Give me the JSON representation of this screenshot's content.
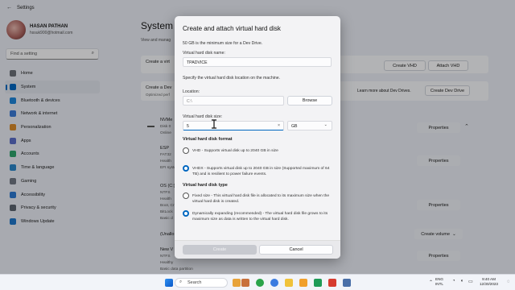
{
  "app": {
    "title": "Settings"
  },
  "user": {
    "name": "HASAN PATHAN",
    "email": "hssuk900@hotmail.com"
  },
  "search": {
    "placeholder": "Find a setting"
  },
  "nav": [
    {
      "label": "Home",
      "icon": "home-icon",
      "color": "#6b6f78"
    },
    {
      "label": "System",
      "icon": "system-icon",
      "color": "#0067c0",
      "active": true
    },
    {
      "label": "Bluetooth & devices",
      "icon": "bluetooth-icon",
      "color": "#1f86d9"
    },
    {
      "label": "Network & internet",
      "icon": "network-icon",
      "color": "#3b7ad6"
    },
    {
      "label": "Personalization",
      "icon": "brush-icon",
      "color": "#d98b2b"
    },
    {
      "label": "Apps",
      "icon": "apps-icon",
      "color": "#5b6cc7"
    },
    {
      "label": "Accounts",
      "icon": "account-icon",
      "color": "#2da36b"
    },
    {
      "label": "Time & language",
      "icon": "clock-icon",
      "color": "#2a86c8"
    },
    {
      "label": "Gaming",
      "icon": "gaming-icon",
      "color": "#6f7683"
    },
    {
      "label": "Accessibility",
      "icon": "accessibility-icon",
      "color": "#2b78d0"
    },
    {
      "label": "Privacy & security",
      "icon": "shield-icon",
      "color": "#5c6470"
    },
    {
      "label": "Windows Update",
      "icon": "update-icon",
      "color": "#1f76c9"
    }
  ],
  "page": {
    "title": "System",
    "subtitle": "View and manag"
  },
  "cards": {
    "create_vhd": {
      "title": "Create a virt",
      "sub": "",
      "btn1": "Create VHD",
      "btn2": "Attach VHD"
    },
    "dev_drive": {
      "title": "Create a Dev",
      "sub": "Optimized perf",
      "link": "Learn more about Dev Drives.",
      "btn": "Create Dev Drive"
    }
  },
  "disks": {
    "nvme": {
      "title": "NVMe",
      "lines": [
        "Disk 0",
        "Online"
      ],
      "btn": "Properties"
    },
    "esp": {
      "title": "ESP",
      "lines": [
        "FAT32",
        "Health",
        "EFI syste"
      ],
      "btn": "Properties"
    },
    "os": {
      "title": "OS (C:)",
      "lines": [
        "NTFS",
        "Health",
        "Boot, Cr",
        "BitLock",
        "Basic d"
      ],
      "btn": "Properties"
    },
    "unalloc": {
      "title": "(Unallo",
      "btn": "Create volume"
    },
    "newvol": {
      "title": "New V",
      "lines": [
        "NTFS",
        "Healthy",
        "Basic data partition"
      ],
      "btn": "Properties"
    }
  },
  "dialog": {
    "title": "Create and attach virtual hard disk",
    "min_note": "50 GB is the minimum size for a Dev Drive.",
    "name_label": "Virtual hard disk name:",
    "name_value": "TPADVICE",
    "location_note": "Specify the virtual hard disk location on the machine.",
    "location_label": "Location:",
    "location_placeholder": "C:\\",
    "browse": "Browse",
    "size_label": "Virtual hard disk size:",
    "size_value": "5",
    "size_clear": "×",
    "unit": "GB",
    "format_heading": "Virtual hard disk format",
    "format_vhd": "VHD - Supports virtual disk up to 2040 GB in size",
    "format_vhdx": "VHDX - Supports virtual disk up to 2040 GB in size (Supported maximum of 64 TB) and is resilient to power failure events.",
    "type_heading": "Virtual hard disk type",
    "type_fixed": "Fixed size - This virtual hard disk file is allocated to its maximum size when the virtual hard disk is created.",
    "type_dynamic": "Dynamically expanding (recommended) - The virtual hard disk file grows to its maximum size as data is written to the virtual hard disk.",
    "create": "Create",
    "cancel": "Cancel"
  },
  "taskbar": {
    "search": "Search",
    "lang1": "ENG",
    "lang2": "INTL",
    "time": "9:40 AM",
    "date": "12/30/2023"
  },
  "colors": {
    "accent": "#0067c0"
  }
}
